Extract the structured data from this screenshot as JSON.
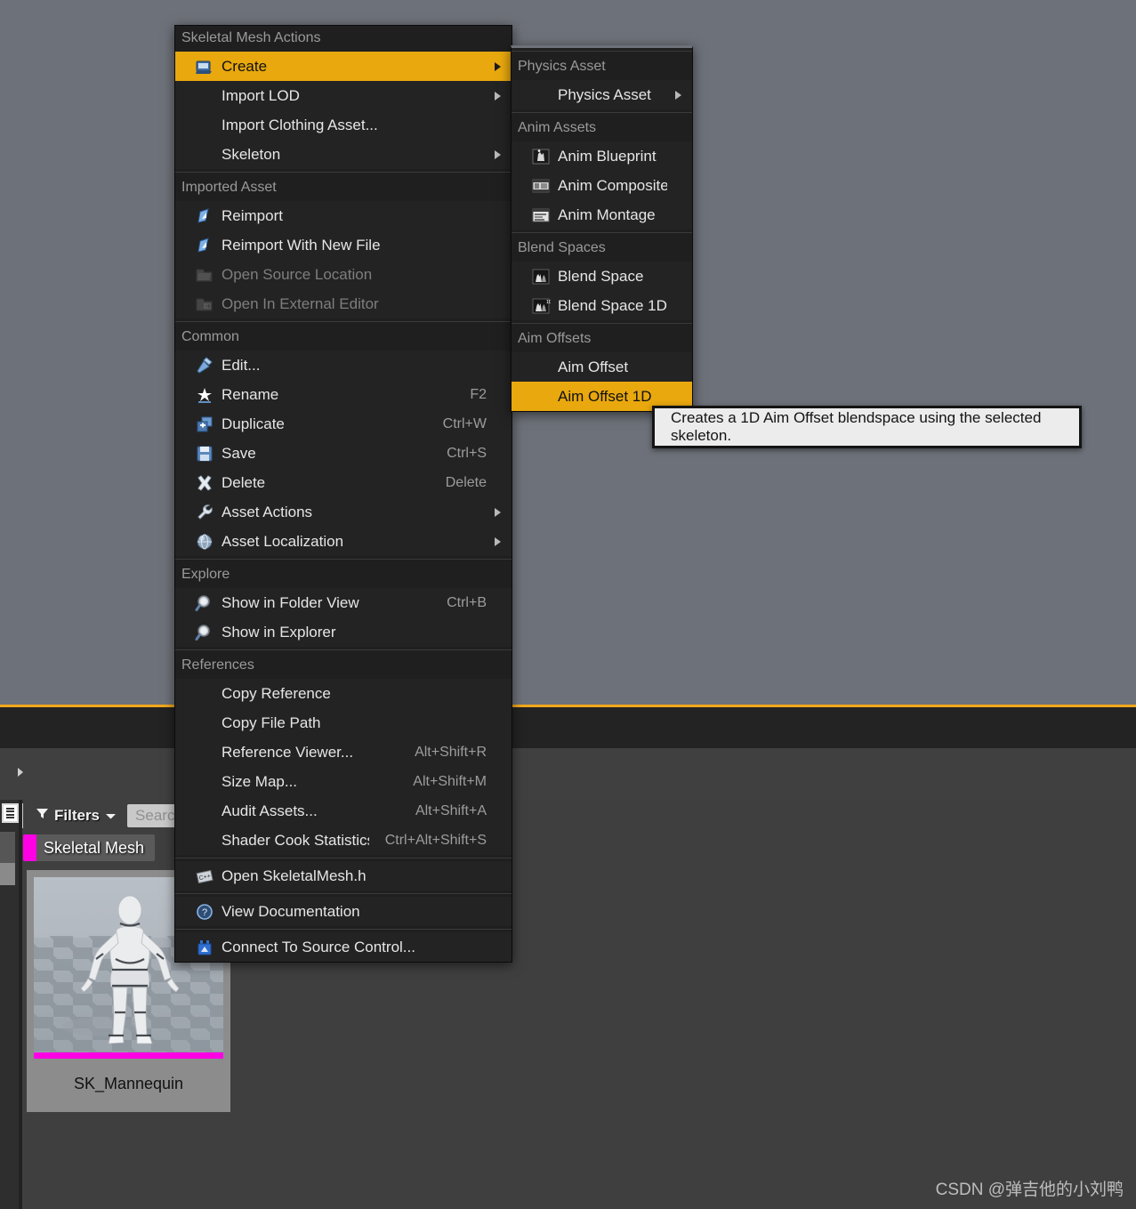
{
  "background": {
    "viewport_color": "#6d7179",
    "accent_color": "#f0a71c",
    "panel_dark": "#232323",
    "panel_mid": "#404040"
  },
  "content_browser": {
    "filters_label": "Filters",
    "search_placeholder": "Search",
    "search_value": "",
    "filter_chip": {
      "label": "Skeletal Mesh",
      "color": "#ff00e4"
    },
    "asset": {
      "name": "SK_Mannequin",
      "type_color": "#ff00e4"
    }
  },
  "watermark": "CSDN @弹吉他的小刘鸭",
  "context_menu": {
    "title": "Skeletal Mesh Actions",
    "sections": [
      {
        "header": null,
        "items": [
          {
            "label": "Create",
            "icon": "create-icon",
            "shortcut": "",
            "submenu": true,
            "selected": true,
            "disabled": false
          },
          {
            "label": "Import LOD",
            "icon": "",
            "shortcut": "",
            "submenu": true,
            "selected": false,
            "disabled": false
          },
          {
            "label": "Import Clothing Asset...",
            "icon": "",
            "shortcut": "",
            "submenu": false,
            "selected": false,
            "disabled": false
          },
          {
            "label": "Skeleton",
            "icon": "",
            "shortcut": "",
            "submenu": true,
            "selected": false,
            "disabled": false
          }
        ]
      },
      {
        "header": "Imported Asset",
        "items": [
          {
            "label": "Reimport",
            "icon": "reimport-icon",
            "shortcut": "",
            "submenu": false,
            "selected": false,
            "disabled": false
          },
          {
            "label": "Reimport With New File",
            "icon": "reimport-icon",
            "shortcut": "",
            "submenu": false,
            "selected": false,
            "disabled": false
          },
          {
            "label": "Open Source Location",
            "icon": "folder-open-icon",
            "shortcut": "",
            "submenu": false,
            "selected": false,
            "disabled": true
          },
          {
            "label": "Open In External Editor",
            "icon": "external-editor-icon",
            "shortcut": "",
            "submenu": false,
            "selected": false,
            "disabled": true
          }
        ]
      },
      {
        "header": "Common",
        "items": [
          {
            "label": "Edit...",
            "icon": "hammer-icon",
            "shortcut": "",
            "submenu": false,
            "selected": false,
            "disabled": false
          },
          {
            "label": "Rename",
            "icon": "rename-icon",
            "shortcut": "F2",
            "submenu": false,
            "selected": false,
            "disabled": false
          },
          {
            "label": "Duplicate",
            "icon": "duplicate-icon",
            "shortcut": "Ctrl+W",
            "submenu": false,
            "selected": false,
            "disabled": false
          },
          {
            "label": "Save",
            "icon": "save-icon",
            "shortcut": "Ctrl+S",
            "submenu": false,
            "selected": false,
            "disabled": false
          },
          {
            "label": "Delete",
            "icon": "delete-icon",
            "shortcut": "Delete",
            "submenu": false,
            "selected": false,
            "disabled": false
          },
          {
            "label": "Asset Actions",
            "icon": "wrench-icon",
            "shortcut": "",
            "submenu": true,
            "selected": false,
            "disabled": false
          },
          {
            "label": "Asset Localization",
            "icon": "globe-icon",
            "shortcut": "",
            "submenu": true,
            "selected": false,
            "disabled": false
          }
        ]
      },
      {
        "header": "Explore",
        "items": [
          {
            "label": "Show in Folder View",
            "icon": "magnifier-icon",
            "shortcut": "Ctrl+B",
            "submenu": false,
            "selected": false,
            "disabled": false
          },
          {
            "label": "Show in Explorer",
            "icon": "magnifier-icon",
            "shortcut": "",
            "submenu": false,
            "selected": false,
            "disabled": false
          }
        ]
      },
      {
        "header": "References",
        "items": [
          {
            "label": "Copy Reference",
            "icon": "",
            "shortcut": "",
            "submenu": false,
            "selected": false,
            "disabled": false
          },
          {
            "label": "Copy File Path",
            "icon": "",
            "shortcut": "",
            "submenu": false,
            "selected": false,
            "disabled": false
          },
          {
            "label": "Reference Viewer...",
            "icon": "",
            "shortcut": "Alt+Shift+R",
            "submenu": false,
            "selected": false,
            "disabled": false
          },
          {
            "label": "Size Map...",
            "icon": "",
            "shortcut": "Alt+Shift+M",
            "submenu": false,
            "selected": false,
            "disabled": false
          },
          {
            "label": "Audit Assets...",
            "icon": "",
            "shortcut": "Alt+Shift+A",
            "submenu": false,
            "selected": false,
            "disabled": false
          },
          {
            "label": "Shader Cook Statistics...",
            "icon": "",
            "shortcut": "Ctrl+Alt+Shift+S",
            "submenu": false,
            "selected": false,
            "disabled": false
          }
        ]
      },
      {
        "header": null,
        "items": [
          {
            "label": "Open SkeletalMesh.h",
            "icon": "cpp-icon",
            "shortcut": "",
            "submenu": false,
            "selected": false,
            "disabled": false
          }
        ]
      },
      {
        "header": null,
        "items": [
          {
            "label": "View Documentation",
            "icon": "help-icon",
            "shortcut": "",
            "submenu": false,
            "selected": false,
            "disabled": false
          }
        ]
      },
      {
        "header": null,
        "items": [
          {
            "label": "Connect To Source Control...",
            "icon": "source-control-icon",
            "shortcut": "",
            "submenu": false,
            "selected": false,
            "disabled": false
          }
        ]
      }
    ]
  },
  "submenu": {
    "sections": [
      {
        "header": "Physics Asset",
        "items": [
          {
            "label": "Physics Asset",
            "icon": "",
            "shortcut": "",
            "submenu": true,
            "selected": false,
            "disabled": false
          }
        ]
      },
      {
        "header": "Anim Assets",
        "items": [
          {
            "label": "Anim Blueprint",
            "icon": "anim-blueprint-icon",
            "shortcut": "",
            "submenu": false,
            "selected": false,
            "disabled": false
          },
          {
            "label": "Anim Composite",
            "icon": "anim-composite-icon",
            "shortcut": "",
            "submenu": false,
            "selected": false,
            "disabled": false
          },
          {
            "label": "Anim Montage",
            "icon": "anim-montage-icon",
            "shortcut": "",
            "submenu": false,
            "selected": false,
            "disabled": false
          }
        ]
      },
      {
        "header": "Blend Spaces",
        "items": [
          {
            "label": "Blend Space",
            "icon": "blend-space-icon",
            "shortcut": "",
            "submenu": false,
            "selected": false,
            "disabled": false
          },
          {
            "label": "Blend Space 1D",
            "icon": "blend-space-1d-icon",
            "shortcut": "",
            "submenu": false,
            "selected": false,
            "disabled": false
          }
        ]
      },
      {
        "header": "Aim Offsets",
        "items": [
          {
            "label": "Aim Offset",
            "icon": "",
            "shortcut": "",
            "submenu": false,
            "selected": false,
            "disabled": false
          },
          {
            "label": "Aim Offset 1D",
            "icon": "",
            "shortcut": "",
            "submenu": false,
            "selected": true,
            "disabled": false
          }
        ]
      }
    ]
  },
  "tooltip": {
    "text": "Creates a 1D Aim Offset blendspace using the selected skeleton."
  }
}
